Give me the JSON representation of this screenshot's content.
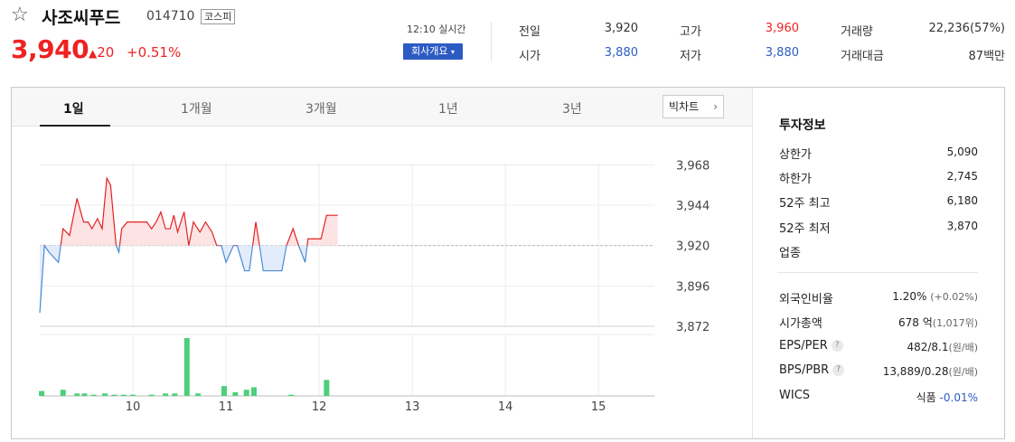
{
  "header": {
    "stock_name": "사조씨푸드",
    "stock_code": "014710",
    "market": "코스피",
    "price": "3,940",
    "change": "20",
    "change_pct": "+0.51%",
    "realtime": "12:10 실시간",
    "company_btn": "회사개요",
    "stats": [
      {
        "label": "전일",
        "value": "3,920",
        "color": "normal"
      },
      {
        "label": "고가",
        "value": "3,960",
        "color": "red"
      },
      {
        "label": "거래량",
        "value": "22,236(57%)",
        "color": "normal"
      },
      {
        "label": "시가",
        "value": "3,880",
        "color": "blue"
      },
      {
        "label": "저가",
        "value": "3,880",
        "color": "blue"
      },
      {
        "label": "거래대금",
        "value": "87백만",
        "color": "normal"
      }
    ]
  },
  "tabs": {
    "items": [
      "1일",
      "1개월",
      "3개월",
      "1년",
      "3년"
    ],
    "active": 0,
    "bigchart": "빅차트"
  },
  "chart_data": {
    "type": "line",
    "base": 3920,
    "ylim": [
      3872,
      3980
    ],
    "yticks": [
      3968,
      3944,
      3920,
      3896,
      3872
    ],
    "ytick_labels": [
      "3,968",
      "3,944",
      "3,920",
      "3,896",
      "3,872"
    ],
    "xticks": [
      10,
      11,
      12,
      13,
      14,
      15
    ],
    "xtick_labels": [
      "10",
      "11",
      "12",
      "13",
      "14",
      "15"
    ],
    "xlim": [
      9.0,
      15.6
    ],
    "price_series": [
      [
        9.0,
        3880
      ],
      [
        9.05,
        3920
      ],
      [
        9.1,
        3916
      ],
      [
        9.2,
        3910
      ],
      [
        9.25,
        3930
      ],
      [
        9.32,
        3926
      ],
      [
        9.4,
        3948
      ],
      [
        9.47,
        3934
      ],
      [
        9.52,
        3934
      ],
      [
        9.56,
        3930
      ],
      [
        9.62,
        3936
      ],
      [
        9.67,
        3930
      ],
      [
        9.72,
        3960
      ],
      [
        9.76,
        3956
      ],
      [
        9.82,
        3920
      ],
      [
        9.85,
        3916
      ],
      [
        9.88,
        3930
      ],
      [
        9.94,
        3934
      ],
      [
        10.0,
        3934
      ],
      [
        10.15,
        3934
      ],
      [
        10.2,
        3930
      ],
      [
        10.25,
        3934
      ],
      [
        10.3,
        3940
      ],
      [
        10.35,
        3930
      ],
      [
        10.4,
        3930
      ],
      [
        10.44,
        3938
      ],
      [
        10.48,
        3928
      ],
      [
        10.55,
        3940
      ],
      [
        10.6,
        3920
      ],
      [
        10.65,
        3934
      ],
      [
        10.72,
        3928
      ],
      [
        10.78,
        3934
      ],
      [
        10.85,
        3928
      ],
      [
        10.9,
        3920
      ],
      [
        10.95,
        3920
      ],
      [
        11.0,
        3910
      ],
      [
        11.08,
        3920
      ],
      [
        11.12,
        3920
      ],
      [
        11.2,
        3905
      ],
      [
        11.25,
        3905
      ],
      [
        11.32,
        3934
      ],
      [
        11.36,
        3920
      ],
      [
        11.4,
        3905
      ],
      [
        11.6,
        3905
      ],
      [
        11.65,
        3920
      ],
      [
        11.72,
        3930
      ],
      [
        11.78,
        3920
      ],
      [
        11.85,
        3910
      ],
      [
        11.88,
        3924
      ],
      [
        11.92,
        3924
      ],
      [
        12.02,
        3924
      ],
      [
        12.08,
        3938
      ],
      [
        12.2,
        3938
      ]
    ],
    "volume_series": [
      [
        9.02,
        4
      ],
      [
        9.25,
        5
      ],
      [
        9.4,
        2
      ],
      [
        9.48,
        2
      ],
      [
        9.58,
        1
      ],
      [
        9.7,
        2
      ],
      [
        9.8,
        1
      ],
      [
        9.9,
        1
      ],
      [
        10.0,
        1
      ],
      [
        10.2,
        1
      ],
      [
        10.35,
        2
      ],
      [
        10.45,
        2
      ],
      [
        10.58,
        47
      ],
      [
        10.7,
        2
      ],
      [
        10.98,
        8
      ],
      [
        11.1,
        3
      ],
      [
        11.22,
        5
      ],
      [
        11.3,
        7
      ],
      [
        11.7,
        1
      ],
      [
        12.08,
        13
      ]
    ],
    "volume_max": 47
  },
  "info": {
    "title": "투자정보",
    "rows1": [
      {
        "label": "상한가",
        "value": "5,090",
        "color": "red"
      },
      {
        "label": "하한가",
        "value": "2,745",
        "color": "blue"
      },
      {
        "label": "52주 최고",
        "value": "6,180",
        "color": "normal"
      },
      {
        "label": "52주 최저",
        "value": "3,870",
        "color": "normal"
      },
      {
        "label": "업종",
        "value": "",
        "color": "normal"
      }
    ],
    "foreign": {
      "label": "외국인비율",
      "value": "1.20%",
      "sub": "(+0.02%)"
    },
    "mcap": {
      "label": "시가총액",
      "value": "678 억",
      "sub": "(1,017위)"
    },
    "eps": {
      "label": "EPS/PER",
      "value": "482/8.1",
      "sub": "(원/배)",
      "help": "?"
    },
    "bps": {
      "label": "BPS/PBR",
      "value": "13,889/0.28",
      "sub": "(원/배)",
      "help": "?"
    },
    "wics": {
      "label": "WICS",
      "value": "식품",
      "change": "-0.01%"
    }
  },
  "colors": {
    "up": "#e22222",
    "down": "#2d5bc4",
    "volume": "#4cd07a"
  }
}
